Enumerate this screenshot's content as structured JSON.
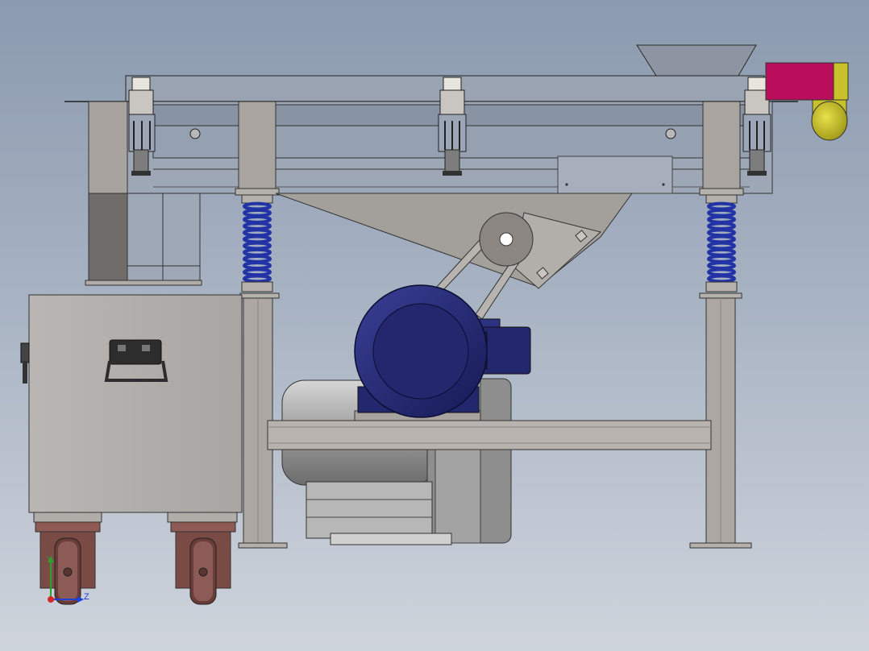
{
  "colors": {
    "background_top": "#8b9aaf",
    "background_bottom": "#cfd4dc",
    "steel": "#a9a49f",
    "steel_dark": "#807b77",
    "motor_blue": "#23286e",
    "spring_blue": "#2233a6",
    "outlet_magenta": "#b80e5c",
    "outlet_yellow": "#c9c12a",
    "caster_brown": "#7a4b45"
  },
  "triad": {
    "y_label": "Y",
    "z_label": "Z",
    "x_icon": "axis-origin-dot",
    "y_color": "#2ca02c",
    "z_color": "#1f3fd6"
  }
}
